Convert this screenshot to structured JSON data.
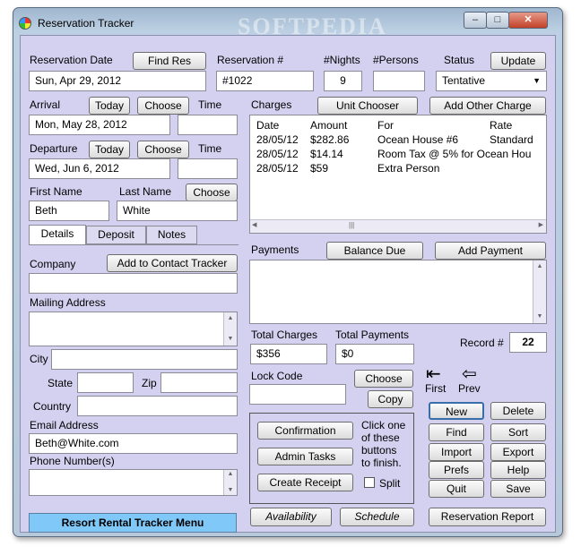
{
  "window": {
    "title": "Reservation Tracker",
    "watermark": "SOFTPEDIA",
    "controls": {
      "minimize": "–",
      "maximize": "□",
      "close": "✕"
    }
  },
  "reservation": {
    "date_label": "Reservation Date",
    "date_value": "Sun, Apr 29, 2012",
    "find_res": "Find Res",
    "number_label": "Reservation #",
    "number_value": "#1022",
    "nights_label": "#Nights",
    "nights_value": "9",
    "persons_label": "#Persons",
    "persons_value": "",
    "status_label": "Status",
    "status_value": "Tentative",
    "update": "Update"
  },
  "arrival": {
    "label": "Arrival",
    "today": "Today",
    "choose": "Choose",
    "time_label": "Time",
    "value": "Mon, May 28, 2012",
    "time_value": ""
  },
  "departure": {
    "label": "Departure",
    "today": "Today",
    "choose": "Choose",
    "time_label": "Time",
    "value": "Wed, Jun 6, 2012",
    "time_value": ""
  },
  "name": {
    "first_label": "First Name",
    "last_label": "Last Name",
    "choose": "Choose",
    "first_value": "Beth",
    "last_value": "White"
  },
  "tabs": [
    "Details",
    "Deposit",
    "Notes"
  ],
  "details": {
    "company_label": "Company",
    "add_contact": "Add to Contact Tracker",
    "company_value": "",
    "mailing_label": "Mailing Address",
    "city_label": "City",
    "state_label": "State",
    "zip_label": "Zip",
    "country_label": "Country",
    "email_label": "Email Address",
    "email_value": "Beth@White.com",
    "phone_label": "Phone Number(s)"
  },
  "menu_button": "Resort Rental Tracker Menu",
  "charges": {
    "label": "Charges",
    "unit_chooser": "Unit Chooser",
    "add_other": "Add Other Charge",
    "headers": [
      "Date",
      "Amount",
      "For",
      "Rate"
    ],
    "rows": [
      [
        "28/05/12",
        "$282.86",
        "Ocean House #6",
        "Standard"
      ],
      [
        "28/05/12",
        "$14.14",
        "Room Tax @ 5% for Ocean Hou",
        ""
      ],
      [
        "28/05/12",
        "$59",
        "Extra Person",
        ""
      ]
    ]
  },
  "payments": {
    "label": "Payments",
    "balance_due": "Balance Due",
    "add_payment": "Add Payment"
  },
  "totals": {
    "charges_label": "Total Charges",
    "charges_value": "$356",
    "payments_label": "Total Payments",
    "payments_value": "$0",
    "record_label": "Record #",
    "record_value": "22"
  },
  "lock": {
    "label": "Lock Code",
    "choose": "Choose",
    "copy": "Copy",
    "value": ""
  },
  "nav": {
    "first": "First",
    "prev": "Prev"
  },
  "finish": {
    "confirmation": "Confirmation",
    "admin_tasks": "Admin Tasks",
    "create_receipt": "Create Receipt",
    "hint": [
      "Click one",
      "of these",
      "buttons",
      "to finish."
    ],
    "split": "Split"
  },
  "actions": [
    "New",
    "Delete",
    "Find",
    "Sort",
    "Import",
    "Export",
    "Prefs",
    "Help",
    "Quit",
    "Save"
  ],
  "bottom": {
    "availability": "Availability",
    "schedule": "Schedule",
    "report": "Reservation Report"
  },
  "colors": {
    "client_bg": "#d4d1f0",
    "menu_button": "#7fc8f8"
  }
}
